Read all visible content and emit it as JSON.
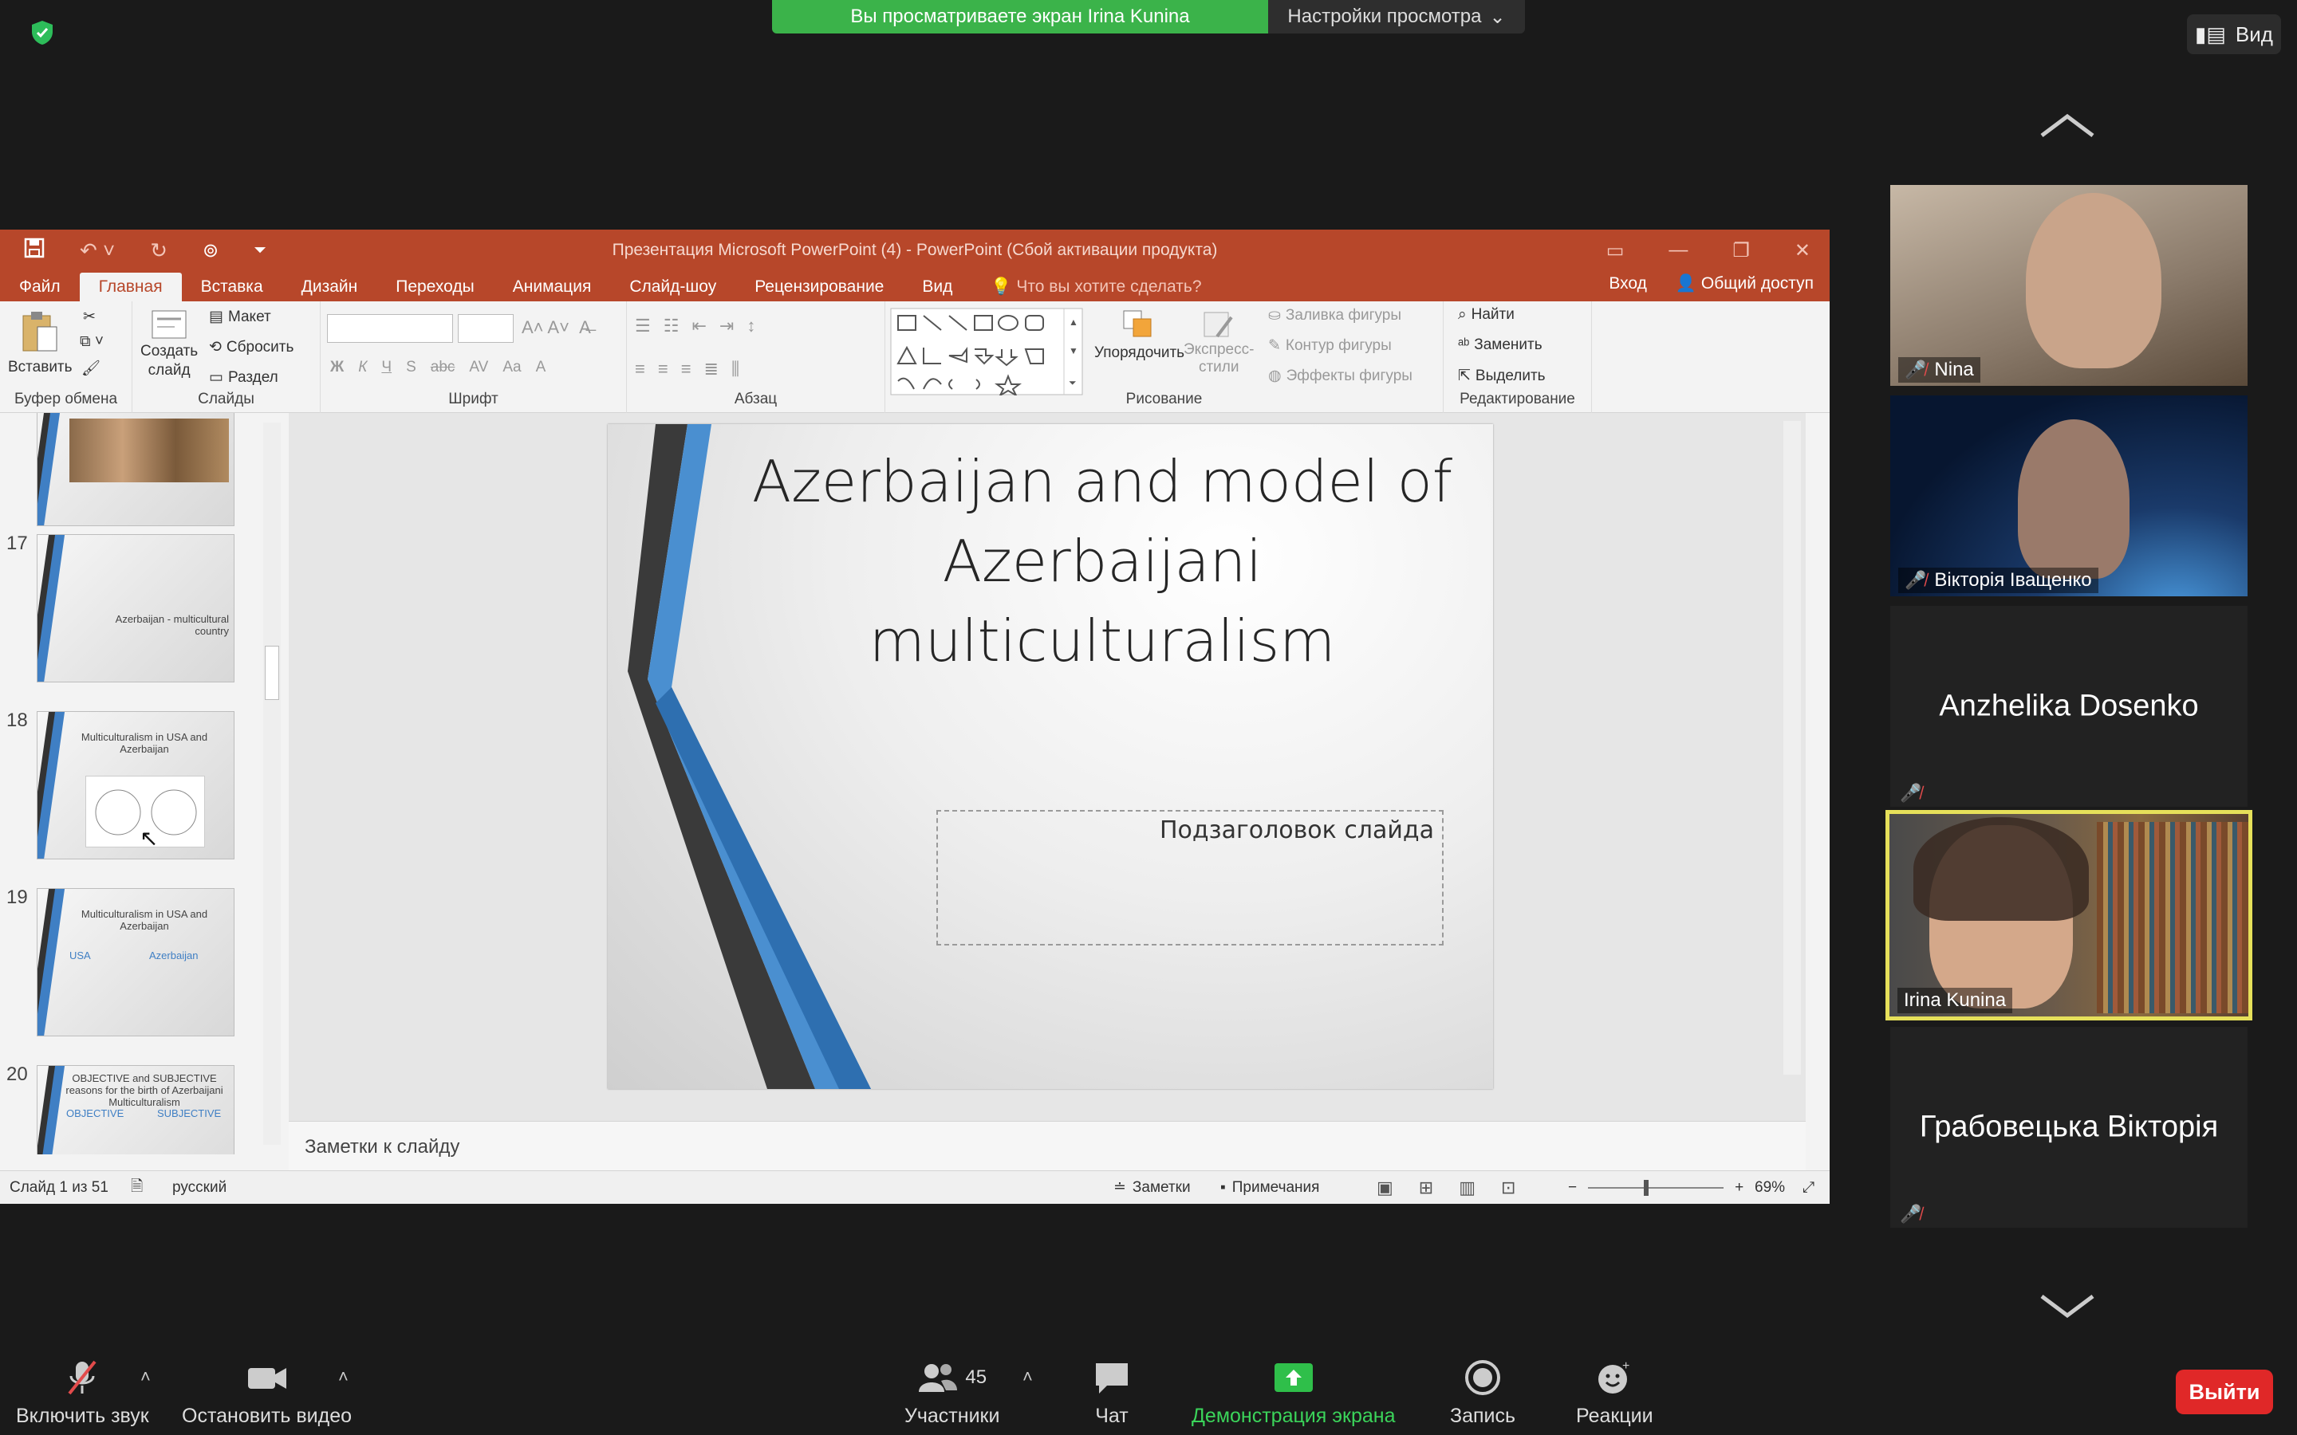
{
  "zoom_top": {
    "banner_text": "Вы просматриваете экран Irina Kunina",
    "view_settings": "Настройки просмотра",
    "view_button": "Вид"
  },
  "ppt": {
    "window_title": "Презентация Microsoft PowerPoint (4) - PowerPoint (Сбой активации продукта)",
    "tabs": [
      "Файл",
      "Главная",
      "Вставка",
      "Дизайн",
      "Переходы",
      "Анимация",
      "Слайд-шоу",
      "Рецензирование",
      "Вид"
    ],
    "tell_me": "Что вы хотите сделать?",
    "sign_in": "Вход",
    "share": "Общий доступ",
    "ribbon": {
      "paste": "Вставить",
      "new_slide_1": "Создать",
      "new_slide_2": "слайд",
      "layout": "Макет",
      "reset": "Сбросить",
      "section": "Раздел",
      "arrange": "Упорядочить",
      "quick_styles_1": "Экспресс-",
      "quick_styles_2": "стили",
      "shape_fill": "Заливка фигуры",
      "shape_outline": "Контур фигуры",
      "shape_effects": "Эффекты фигуры",
      "find": "Найти",
      "replace": "Заменить",
      "select": "Выделить",
      "groups": {
        "clipboard": "Буфер обмена",
        "slides": "Слайды",
        "font": "Шрифт",
        "paragraph": "Абзац",
        "drawing": "Рисование",
        "editing": "Редактирование"
      },
      "font_buttons": [
        "Ж",
        "К",
        "Ч",
        "S",
        "abc",
        "AV",
        "Aa",
        "A"
      ]
    },
    "thumbnails": [
      {
        "num": "",
        "text": ""
      },
      {
        "num": "17",
        "text": "Azerbaijan - multicultural country"
      },
      {
        "num": "18",
        "text": "Multiculturalism in USA and Azerbaijan"
      },
      {
        "num": "19",
        "text": "Multiculturalism in USA and Azerbaijan"
      },
      {
        "num": "20",
        "text": "OBJECTIVE and SUBJECTIVE reasons for the birth of Azerbaijani Multiculturalism"
      }
    ],
    "thumb19_cols": [
      "USA",
      "Azerbaijan"
    ],
    "thumb20_cols": [
      "OBJECTIVE",
      "SUBJECTIVE"
    ],
    "slide": {
      "title": "Azerbaijan and  model of Azerbaijani multiculturalism",
      "subtitle": "Подзаголовок слайда"
    },
    "notes_placeholder": "Заметки к слайду",
    "status": {
      "slide_counter": "Слайд 1 из 51",
      "language": "русский",
      "notes": "Заметки",
      "comments": "Примечания",
      "zoom": "69%"
    }
  },
  "participants": [
    {
      "name": "Nina",
      "type": "video",
      "muted": true,
      "bg": "#9a8a7a"
    },
    {
      "name": "Вікторія Іващенко",
      "type": "video",
      "muted": true,
      "bg": "#1a3a6a"
    },
    {
      "name": "Anzhelika Dosenko",
      "type": "name",
      "muted": true
    },
    {
      "name": "Irina Kunina",
      "type": "video",
      "muted": false,
      "active": true,
      "bg": "#8a6a50"
    },
    {
      "name": "Грабовецька Вікторія",
      "type": "name",
      "muted": true
    }
  ],
  "toolbar": {
    "unmute": "Включить звук",
    "stop_video": "Остановить видео",
    "participants": "Участники",
    "participants_count": "45",
    "chat": "Чат",
    "share_screen": "Демонстрация экрана",
    "record": "Запись",
    "reactions": "Реакции",
    "leave": "Выйти"
  },
  "colors": {
    "ppt_accent": "#b7472a",
    "zoom_green": "#3bb34a",
    "leave_red": "#e02828",
    "active_speaker": "#e6e05a"
  }
}
